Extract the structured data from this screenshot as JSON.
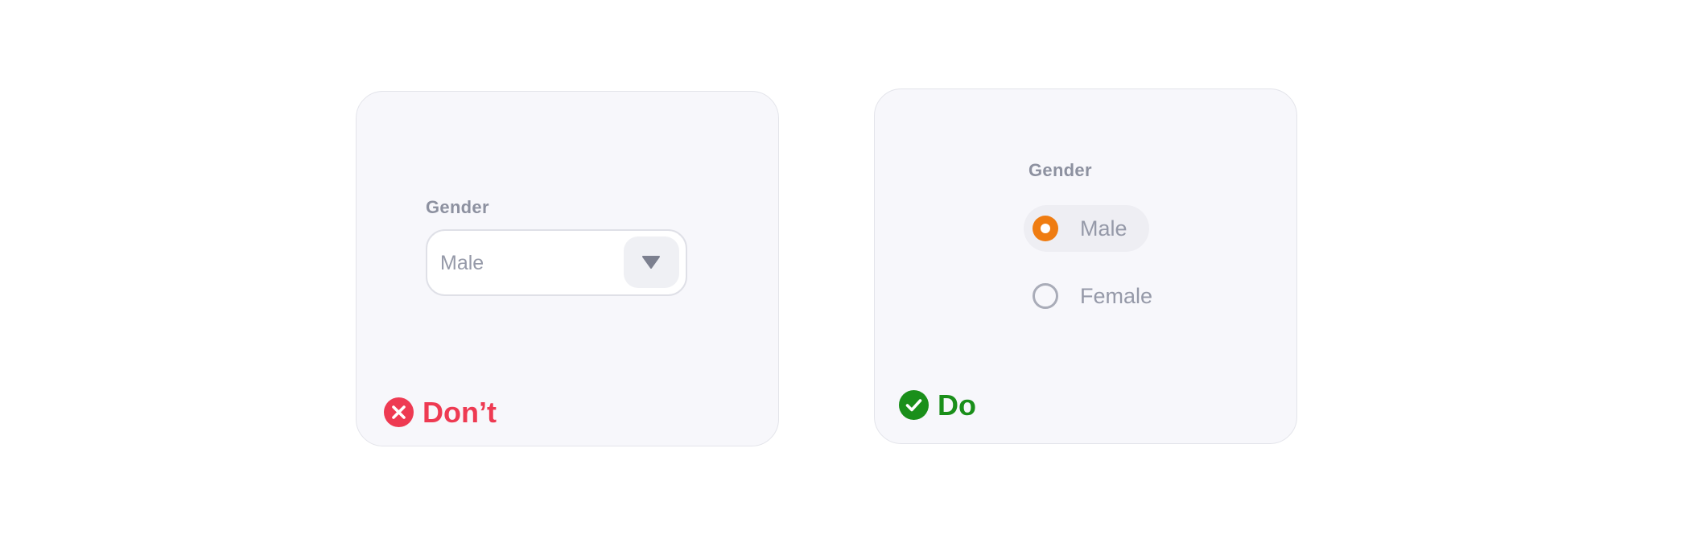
{
  "colors": {
    "dont": "#ee3a52",
    "do": "#1a8f1a",
    "radio_selected": "#ef7c11",
    "label": "#8d91a0",
    "card_background": "#f7f7fb"
  },
  "dont_example": {
    "field_label": "Gender",
    "select": {
      "value": "Male",
      "toggle_icon": "caret-down-icon"
    },
    "verdict": {
      "icon": "x-circle-icon",
      "label": "Don’t"
    }
  },
  "do_example": {
    "field_label": "Gender",
    "options": [
      {
        "label": "Male",
        "selected": true
      },
      {
        "label": "Female",
        "selected": false
      }
    ],
    "verdict": {
      "icon": "check-circle-icon",
      "label": "Do"
    }
  }
}
